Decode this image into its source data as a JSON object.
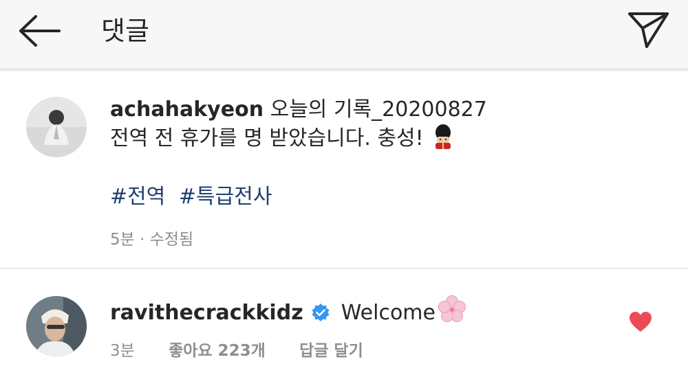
{
  "header": {
    "title": "댓글",
    "back_icon": "arrow-left-icon",
    "share_icon": "paper-plane-icon"
  },
  "post": {
    "username": "achahakyeon",
    "caption_line1": "오늘의 기록_20200827",
    "caption_line2": "전역 전 휴가를 명 받았습니다. 충성!",
    "emoji": "royal-guard-emoji",
    "hashtags": [
      "#전역",
      "#특급전사"
    ],
    "meta": "5분 · 수정됨"
  },
  "comment": {
    "username": "ravithecrackkidz",
    "verified": true,
    "text": "Welcome",
    "emoji": "cherry-blossom-emoji",
    "time": "3분",
    "likes": "좋아요 223개",
    "reply": "답글 달기",
    "liked": true
  },
  "colors": {
    "hashtag": "#1f3f6b",
    "verified": "#3897f0",
    "heart": "#ed4956",
    "meta": "#8e8e8e"
  }
}
